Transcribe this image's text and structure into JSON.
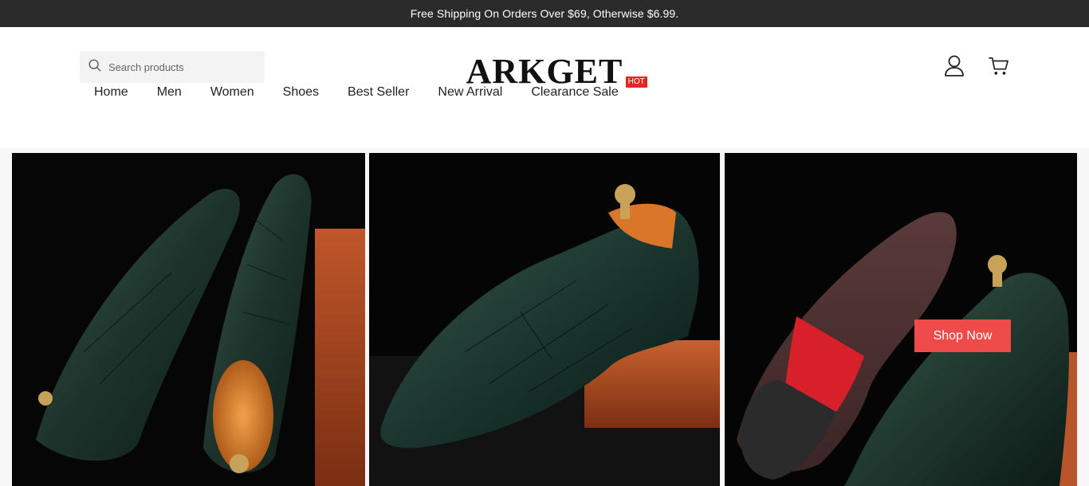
{
  "announcement": "Free Shipping On Orders Over $69, Otherwise $6.99.",
  "search": {
    "placeholder": "Search products"
  },
  "logo": "ARKGET",
  "header_icons": [
    "user-icon",
    "cart-icon"
  ],
  "nav": {
    "items": [
      {
        "label": "Home"
      },
      {
        "label": "Men"
      },
      {
        "label": "Women"
      },
      {
        "label": "Shoes"
      },
      {
        "label": "Best Seller"
      },
      {
        "label": "New Arrival"
      },
      {
        "label": "Clearance Sale",
        "badge": "HOT"
      }
    ]
  },
  "hero": {
    "cta_label": "Shop Now",
    "panels": [
      "shoe-pair-image",
      "shoe-side-image",
      "shoe-sole-image"
    ]
  },
  "colors": {
    "announcement_bg": "#2b2b2b",
    "badge": "#e3261f",
    "cta": "#f04b4b",
    "shoe_green": "#1f3a32"
  }
}
